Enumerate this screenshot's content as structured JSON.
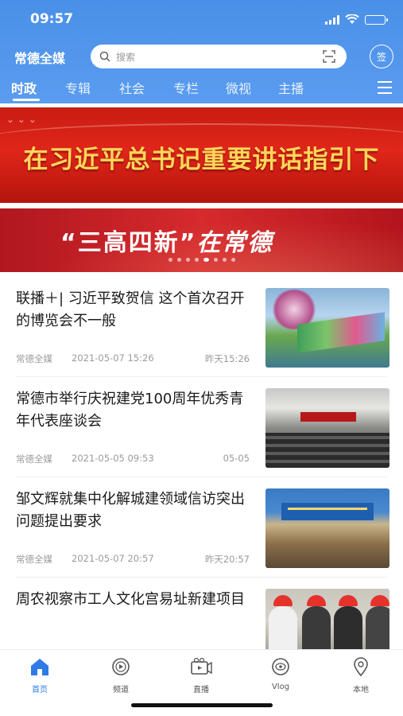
{
  "status": {
    "time": "09:57"
  },
  "header": {
    "logo": "常德全媒",
    "search_placeholder": "搜索",
    "sign_button": "签",
    "tabs": [
      {
        "label": "时政",
        "active": true
      },
      {
        "label": "专辑"
      },
      {
        "label": "社会"
      },
      {
        "label": "专栏"
      },
      {
        "label": "微视"
      },
      {
        "label": "主播"
      }
    ]
  },
  "banners": {
    "headline": "在习近平总书记重要讲话指引下",
    "slogan_main": "“三高四新”",
    "slogan_script": "在常德",
    "carousel_count": 8,
    "carousel_active": 4
  },
  "news": [
    {
      "title": "联播＋| 习近平致贺信 这个首次召开的博览会不一般",
      "source": "常德全媒",
      "date": "2021-05-07 15:26",
      "ago": "昨天15:26"
    },
    {
      "title": "常德市举行庆祝建党100周年优秀青年代表座谈会",
      "source": "常德全媒",
      "date": "2021-05-05 09:53",
      "ago": "05-05"
    },
    {
      "title": "邹文辉就集中化解城建领域信访突出问题提出要求",
      "source": "常德全媒",
      "date": "2021-05-07 20:57",
      "ago": "昨天20:57"
    },
    {
      "title": "周农视察市工人文化宫易址新建项目",
      "source": "",
      "date": "",
      "ago": ""
    }
  ],
  "bottom_nav": [
    {
      "label": "首页",
      "icon": "home-icon",
      "active": true
    },
    {
      "label": "频道",
      "icon": "play-circle-icon"
    },
    {
      "label": "直播",
      "icon": "live-camera-icon"
    },
    {
      "label": "Vlog",
      "icon": "vlog-icon"
    },
    {
      "label": "本地",
      "icon": "location-pin-icon"
    }
  ],
  "colors": {
    "brand_blue": "#4a90e8",
    "nav_active": "#2e7be6",
    "banner_red": "#d62a2d",
    "headline_gold": "#ffd659"
  }
}
